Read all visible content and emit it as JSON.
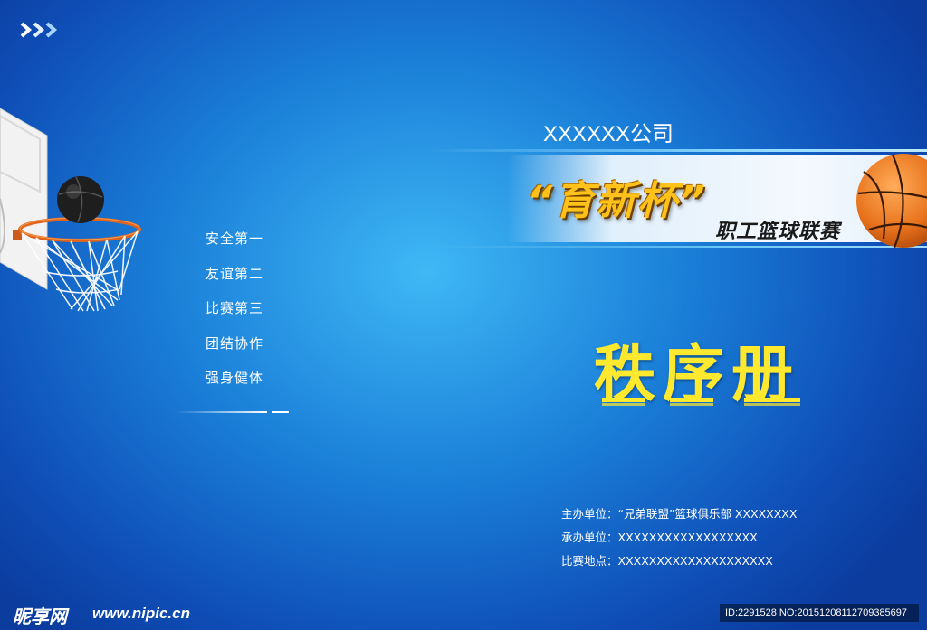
{
  "cover": {
    "company": "XXXXXX公司",
    "banner": {
      "title": "“育新杯”",
      "subtitle": "职工篮球联赛"
    },
    "main_title": "秩序册",
    "mottos": [
      "安全第一",
      "友谊第二",
      "比赛第三",
      "团结协作",
      "强身健体"
    ],
    "info": [
      "主办单位：“兄弟联盟”篮球俱乐部  XXXXXXXX",
      "承办单位：XXXXXXXXXXXXXXXXXX",
      "比赛地点：XXXXXXXXXXXXXXXXXXXX"
    ]
  },
  "watermark": {
    "logo": "昵享网",
    "url": "www.nipic.cn",
    "id_text": "ID:2291528 NO:20151208112709385697"
  },
  "colors": {
    "background_center": "#3fb8f5",
    "background_edge": "#0b3c9e",
    "title_yellow": "#ffe92e",
    "banner_gold": "#ffc21a",
    "basketball_orange": "#e8731c"
  },
  "icons": {
    "corner": "triple-chevron-right-icon",
    "hoop": "basketball-hoop-icon",
    "ball": "basketball-icon"
  }
}
